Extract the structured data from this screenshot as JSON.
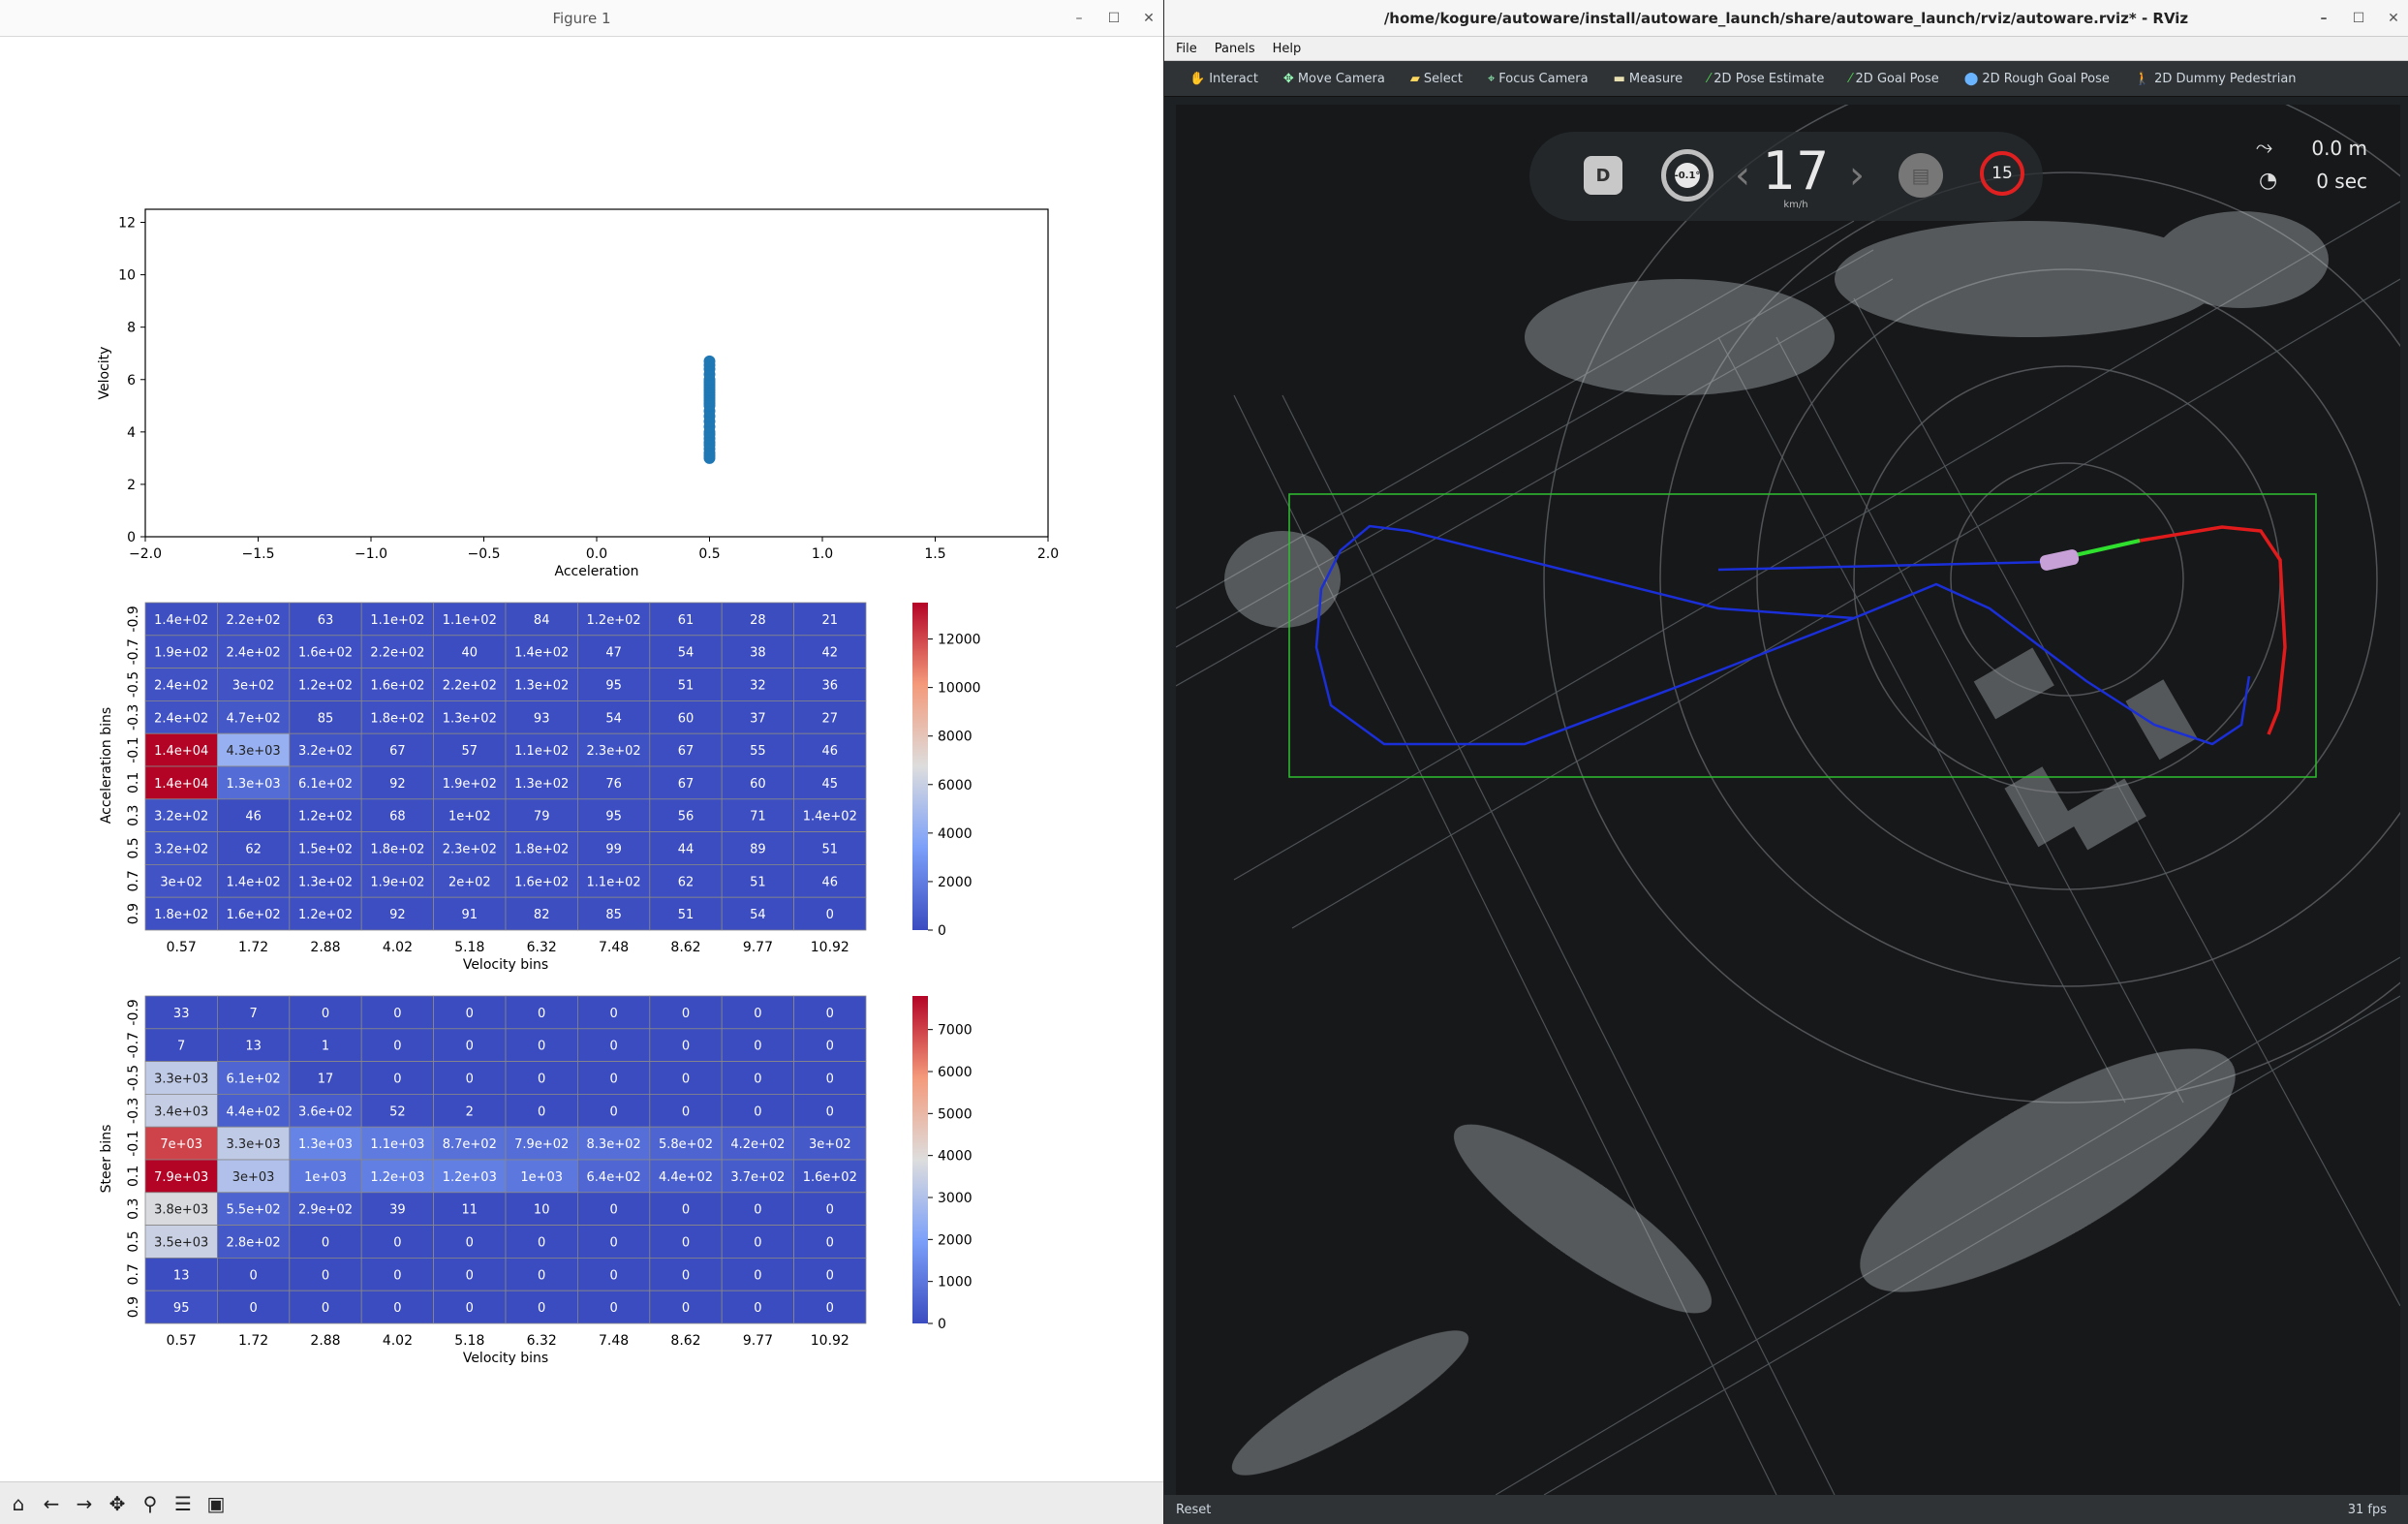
{
  "figure": {
    "title": "Figure 1",
    "scatter": {
      "xlabel": "Acceleration",
      "ylabel": "Velocity",
      "xticks": [
        "−2.0",
        "−1.5",
        "−1.0",
        "−0.5",
        "0.0",
        "0.5",
        "1.0",
        "1.5",
        "2.0"
      ],
      "yticks": [
        "0",
        "2",
        "4",
        "6",
        "8",
        "10",
        "12"
      ],
      "color": "#1f77b4"
    },
    "heatmap1": {
      "ylabel": "Acceleration bins",
      "xlabel": "Velocity bins",
      "colorbar_ticks": [
        "0",
        "2000",
        "4000",
        "6000",
        "8000",
        "10000",
        "12000"
      ]
    },
    "heatmap2": {
      "ylabel": "Steer bins",
      "xlabel": "Velocity bins",
      "colorbar_ticks": [
        "0",
        "1000",
        "2000",
        "3000",
        "4000",
        "5000",
        "6000",
        "7000"
      ]
    }
  },
  "chart_data": [
    {
      "type": "scatter",
      "xlabel": "Acceleration",
      "ylabel": "Velocity",
      "xlim": [
        -2.0,
        2.0
      ],
      "ylim": [
        0,
        12.5
      ],
      "x": [
        0.5,
        0.5,
        0.5,
        0.5,
        0.5,
        0.5,
        0.5,
        0.5,
        0.5,
        0.5,
        0.5,
        0.5,
        0.5,
        0.5,
        0.5,
        0.5,
        0.5,
        0.5,
        0.5,
        0.5,
        0.5,
        0.5,
        0.5,
        0.5,
        0.5,
        0.5,
        0.5,
        0.5
      ],
      "y": [
        3.0,
        3.1,
        3.2,
        3.35,
        3.5,
        3.6,
        3.75,
        3.9,
        4.0,
        4.2,
        4.4,
        4.6,
        4.8,
        5.0,
        5.1,
        5.2,
        5.3,
        5.4,
        5.5,
        5.6,
        5.7,
        5.8,
        5.9,
        6.0,
        6.2,
        6.4,
        6.55,
        6.7
      ]
    },
    {
      "type": "heatmap",
      "xlabel": "Velocity bins",
      "ylabel": "Acceleration bins",
      "x_categories": [
        "0.57",
        "1.72",
        "2.88",
        "4.02",
        "5.18",
        "6.32",
        "7.48",
        "8.62",
        "9.77",
        "10.92"
      ],
      "y_categories": [
        "-0.9",
        "-0.7",
        "-0.5",
        "-0.3",
        "-0.1",
        "0.1",
        "0.3",
        "0.5",
        "0.7",
        "0.9"
      ],
      "vmin": 0,
      "vmax": 13500,
      "values": [
        [
          140,
          220,
          63,
          110,
          110,
          84,
          120,
          61,
          28,
          21
        ],
        [
          190,
          240,
          160,
          220,
          40,
          140,
          47,
          54,
          38,
          42
        ],
        [
          240,
          300,
          120,
          160,
          220,
          130,
          95,
          51,
          32,
          36
        ],
        [
          240,
          470,
          85,
          180,
          130,
          93,
          54,
          60,
          37,
          27
        ],
        [
          14000,
          4300,
          320,
          67,
          57,
          110,
          230,
          67,
          55,
          46
        ],
        [
          14000,
          1300,
          610,
          92,
          190,
          130,
          76,
          67,
          60,
          45
        ],
        [
          320,
          46,
          120,
          68,
          100,
          79,
          95,
          56,
          71,
          140
        ],
        [
          320,
          62,
          150,
          180,
          230,
          180,
          99,
          44,
          89,
          51
        ],
        [
          300,
          140,
          130,
          190,
          200,
          160,
          110,
          62,
          51,
          46
        ],
        [
          180,
          160,
          120,
          92,
          91,
          82,
          85,
          51,
          54,
          0
        ]
      ],
      "labels": [
        [
          "1.4e+02",
          "2.2e+02",
          "63",
          "1.1e+02",
          "1.1e+02",
          "84",
          "1.2e+02",
          "61",
          "28",
          "21"
        ],
        [
          "1.9e+02",
          "2.4e+02",
          "1.6e+02",
          "2.2e+02",
          "40",
          "1.4e+02",
          "47",
          "54",
          "38",
          "42"
        ],
        [
          "2.4e+02",
          "3e+02",
          "1.2e+02",
          "1.6e+02",
          "2.2e+02",
          "1.3e+02",
          "95",
          "51",
          "32",
          "36"
        ],
        [
          "2.4e+02",
          "4.7e+02",
          "85",
          "1.8e+02",
          "1.3e+02",
          "93",
          "54",
          "60",
          "37",
          "27"
        ],
        [
          "1.4e+04",
          "4.3e+03",
          "3.2e+02",
          "67",
          "57",
          "1.1e+02",
          "2.3e+02",
          "67",
          "55",
          "46"
        ],
        [
          "1.4e+04",
          "1.3e+03",
          "6.1e+02",
          "92",
          "1.9e+02",
          "1.3e+02",
          "76",
          "67",
          "60",
          "45"
        ],
        [
          "3.2e+02",
          "46",
          "1.2e+02",
          "68",
          "1e+02",
          "79",
          "95",
          "56",
          "71",
          "1.4e+02"
        ],
        [
          "3.2e+02",
          "62",
          "1.5e+02",
          "1.8e+02",
          "2.3e+02",
          "1.8e+02",
          "99",
          "44",
          "89",
          "51"
        ],
        [
          "3e+02",
          "1.4e+02",
          "1.3e+02",
          "1.9e+02",
          "2e+02",
          "1.6e+02",
          "1.1e+02",
          "62",
          "51",
          "46"
        ],
        [
          "1.8e+02",
          "1.6e+02",
          "1.2e+02",
          "92",
          "91",
          "82",
          "85",
          "51",
          "54",
          "0"
        ]
      ]
    },
    {
      "type": "heatmap",
      "xlabel": "Velocity bins",
      "ylabel": "Steer bins",
      "x_categories": [
        "0.57",
        "1.72",
        "2.88",
        "4.02",
        "5.18",
        "6.32",
        "7.48",
        "8.62",
        "9.77",
        "10.92"
      ],
      "y_categories": [
        "-0.9",
        "-0.7",
        "-0.5",
        "-0.3",
        "-0.1",
        "0.1",
        "0.3",
        "0.5",
        "0.7",
        "0.9"
      ],
      "vmin": 0,
      "vmax": 7800,
      "values": [
        [
          33,
          7,
          0,
          0,
          0,
          0,
          0,
          0,
          0,
          0
        ],
        [
          7,
          13,
          1,
          0,
          0,
          0,
          0,
          0,
          0,
          0
        ],
        [
          3300,
          610,
          17,
          0,
          0,
          0,
          0,
          0,
          0,
          0
        ],
        [
          3400,
          440,
          360,
          52,
          2,
          0,
          0,
          0,
          0,
          0
        ],
        [
          7000,
          3300,
          1300,
          1100,
          870,
          790,
          830,
          580,
          420,
          300
        ],
        [
          7900,
          3000,
          1000,
          1200,
          1200,
          1000,
          640,
          440,
          370,
          160
        ],
        [
          3800,
          550,
          290,
          39,
          11,
          10,
          0,
          0,
          0,
          0
        ],
        [
          3500,
          280,
          0,
          0,
          0,
          0,
          0,
          0,
          0,
          0
        ],
        [
          13,
          0,
          0,
          0,
          0,
          0,
          0,
          0,
          0,
          0
        ],
        [
          95,
          0,
          0,
          0,
          0,
          0,
          0,
          0,
          0,
          0
        ]
      ],
      "labels": [
        [
          "33",
          "7",
          "0",
          "0",
          "0",
          "0",
          "0",
          "0",
          "0",
          "0"
        ],
        [
          "7",
          "13",
          "1",
          "0",
          "0",
          "0",
          "0",
          "0",
          "0",
          "0"
        ],
        [
          "3.3e+03",
          "6.1e+02",
          "17",
          "0",
          "0",
          "0",
          "0",
          "0",
          "0",
          "0"
        ],
        [
          "3.4e+03",
          "4.4e+02",
          "3.6e+02",
          "52",
          "2",
          "0",
          "0",
          "0",
          "0",
          "0"
        ],
        [
          "7e+03",
          "3.3e+03",
          "1.3e+03",
          "1.1e+03",
          "8.7e+02",
          "7.9e+02",
          "8.3e+02",
          "5.8e+02",
          "4.2e+02",
          "3e+02"
        ],
        [
          "7.9e+03",
          "3e+03",
          "1e+03",
          "1.2e+03",
          "1.2e+03",
          "1e+03",
          "6.4e+02",
          "4.4e+02",
          "3.7e+02",
          "1.6e+02"
        ],
        [
          "3.8e+03",
          "5.5e+02",
          "2.9e+02",
          "39",
          "11",
          "10",
          "0",
          "0",
          "0",
          "0"
        ],
        [
          "3.5e+03",
          "2.8e+02",
          "0",
          "0",
          "0",
          "0",
          "0",
          "0",
          "0",
          "0"
        ],
        [
          "13",
          "0",
          "0",
          "0",
          "0",
          "0",
          "0",
          "0",
          "0",
          "0"
        ],
        [
          "95",
          "0",
          "0",
          "0",
          "0",
          "0",
          "0",
          "0",
          "0",
          "0"
        ]
      ]
    }
  ],
  "rviz": {
    "title": "/home/kogure/autoware/install/autoware_launch/share/autoware_launch/rviz/autoware.rviz* - RViz",
    "menu": [
      "File",
      "Panels",
      "Help"
    ],
    "tools": [
      {
        "label": "Interact",
        "icon": "hand-icon"
      },
      {
        "label": "Move Camera",
        "icon": "move-icon"
      },
      {
        "label": "Select",
        "icon": "select-icon"
      },
      {
        "label": "Focus Camera",
        "icon": "focus-icon"
      },
      {
        "label": "Measure",
        "icon": "ruler-icon"
      },
      {
        "label": "2D Pose Estimate",
        "icon": "arrow-icon"
      },
      {
        "label": "2D Goal Pose",
        "icon": "arrow-icon"
      },
      {
        "label": "2D Rough Goal Pose",
        "icon": "pin-icon"
      },
      {
        "label": "2D Dummy Pedestrian",
        "icon": "pedestrian-icon"
      }
    ],
    "hud": {
      "gear": "D",
      "steering": "-0.1°",
      "speed": "17",
      "speed_unit": "km/h",
      "speed_limit": "15",
      "distance": "0.0 m",
      "time": "0 sec"
    },
    "status": {
      "reset": "Reset",
      "fps": "31 fps"
    }
  }
}
